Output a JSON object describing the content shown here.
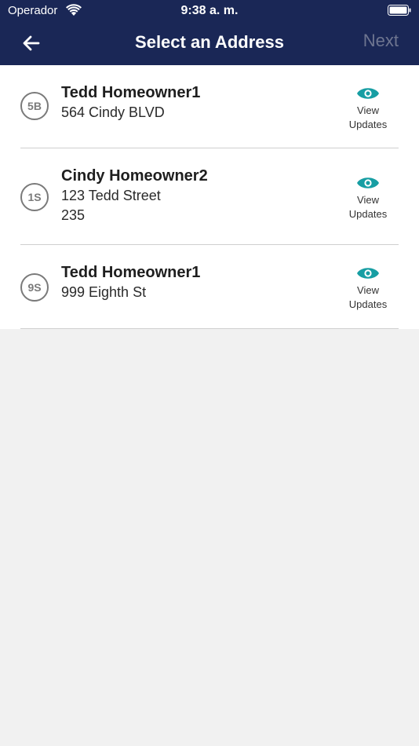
{
  "status_bar": {
    "carrier": "Operador",
    "time": "9:38 a. m."
  },
  "nav": {
    "title": "Select an Address",
    "next_label": "Next"
  },
  "colors": {
    "header_bg": "#1a2756",
    "accent": "#179ea3",
    "badge_gray": "#7a7a7a",
    "next_disabled": "#6e7590"
  },
  "addresses": [
    {
      "badge": "5B",
      "name": "Tedd Homeowner1",
      "line1": "564 Cindy BLVD",
      "line2": "",
      "view_line1": "View",
      "view_line2": "Updates"
    },
    {
      "badge": "1S",
      "name": "Cindy Homeowner2",
      "line1": "123 Tedd Street",
      "line2": "235",
      "view_line1": "View",
      "view_line2": "Updates"
    },
    {
      "badge": "9S",
      "name": "Tedd Homeowner1",
      "line1": "999 Eighth St",
      "line2": "",
      "view_line1": "View",
      "view_line2": "Updates"
    }
  ]
}
